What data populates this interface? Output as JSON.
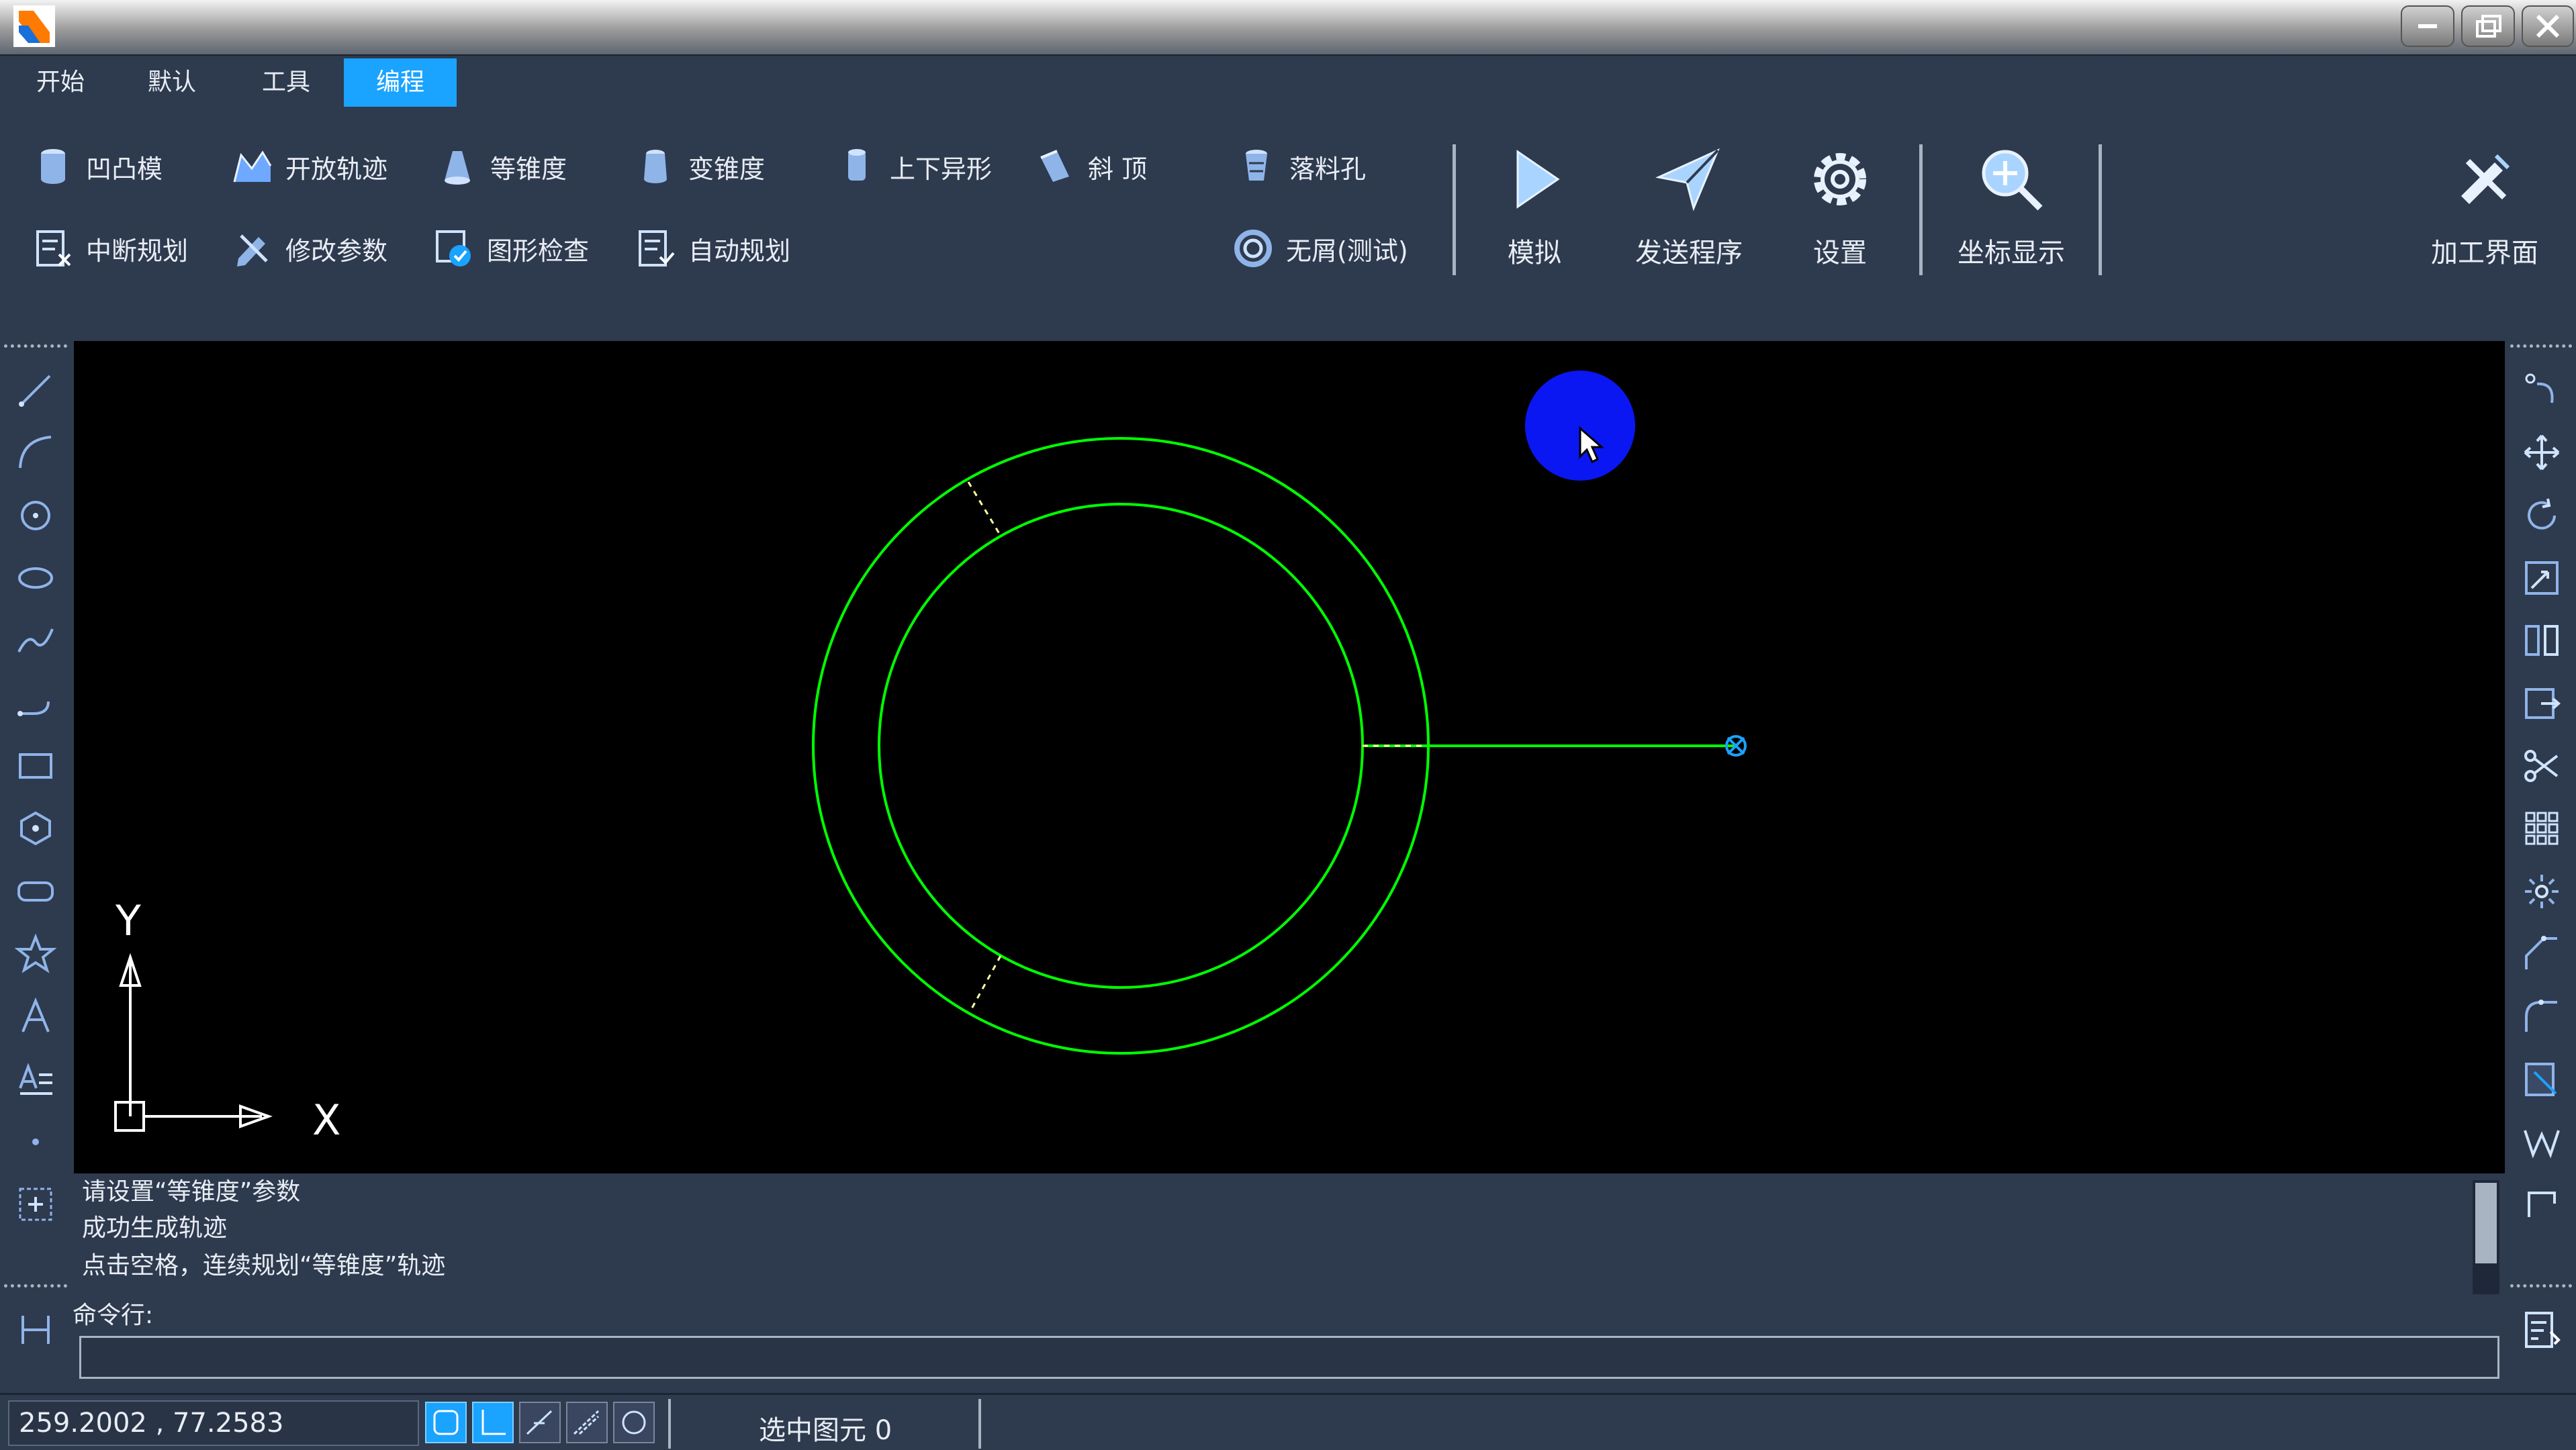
{
  "titlebar": {
    "minimize_icon": "minimize-icon",
    "restore_icon": "restore-icon",
    "close_icon": "close-icon"
  },
  "menu": {
    "tabs": [
      "开始",
      "默认",
      "工具",
      "编程"
    ],
    "active": "编程"
  },
  "ribbon": {
    "row1": [
      "凹凸模",
      "开放轨迹",
      "等锥度",
      "变锥度",
      "上下异形",
      "斜 顶",
      "落料孔"
    ],
    "row2": [
      "中断规划",
      "修改参数",
      "图形检查",
      "自动规划",
      "无屑(测试)"
    ],
    "big": [
      "模拟",
      "发送程序",
      "设置",
      "坐标显示",
      "加工界面"
    ]
  },
  "canvas": {
    "axis_x": "X",
    "axis_y": "Y"
  },
  "output": {
    "lines": [
      "请设置“等锥度”参数",
      "成功生成轨迹",
      "点击空格，连续规划“等锥度”轨迹"
    ]
  },
  "command": {
    "label": "命令行:",
    "value": ""
  },
  "status": {
    "coords": "259.2002 , 77.2583",
    "selected": "选中图元 0"
  },
  "colors": {
    "background": "#2e3a4e",
    "accent": "#1aa3ff",
    "drawing": "#00ff00",
    "click_marker": "#0a17f2"
  }
}
